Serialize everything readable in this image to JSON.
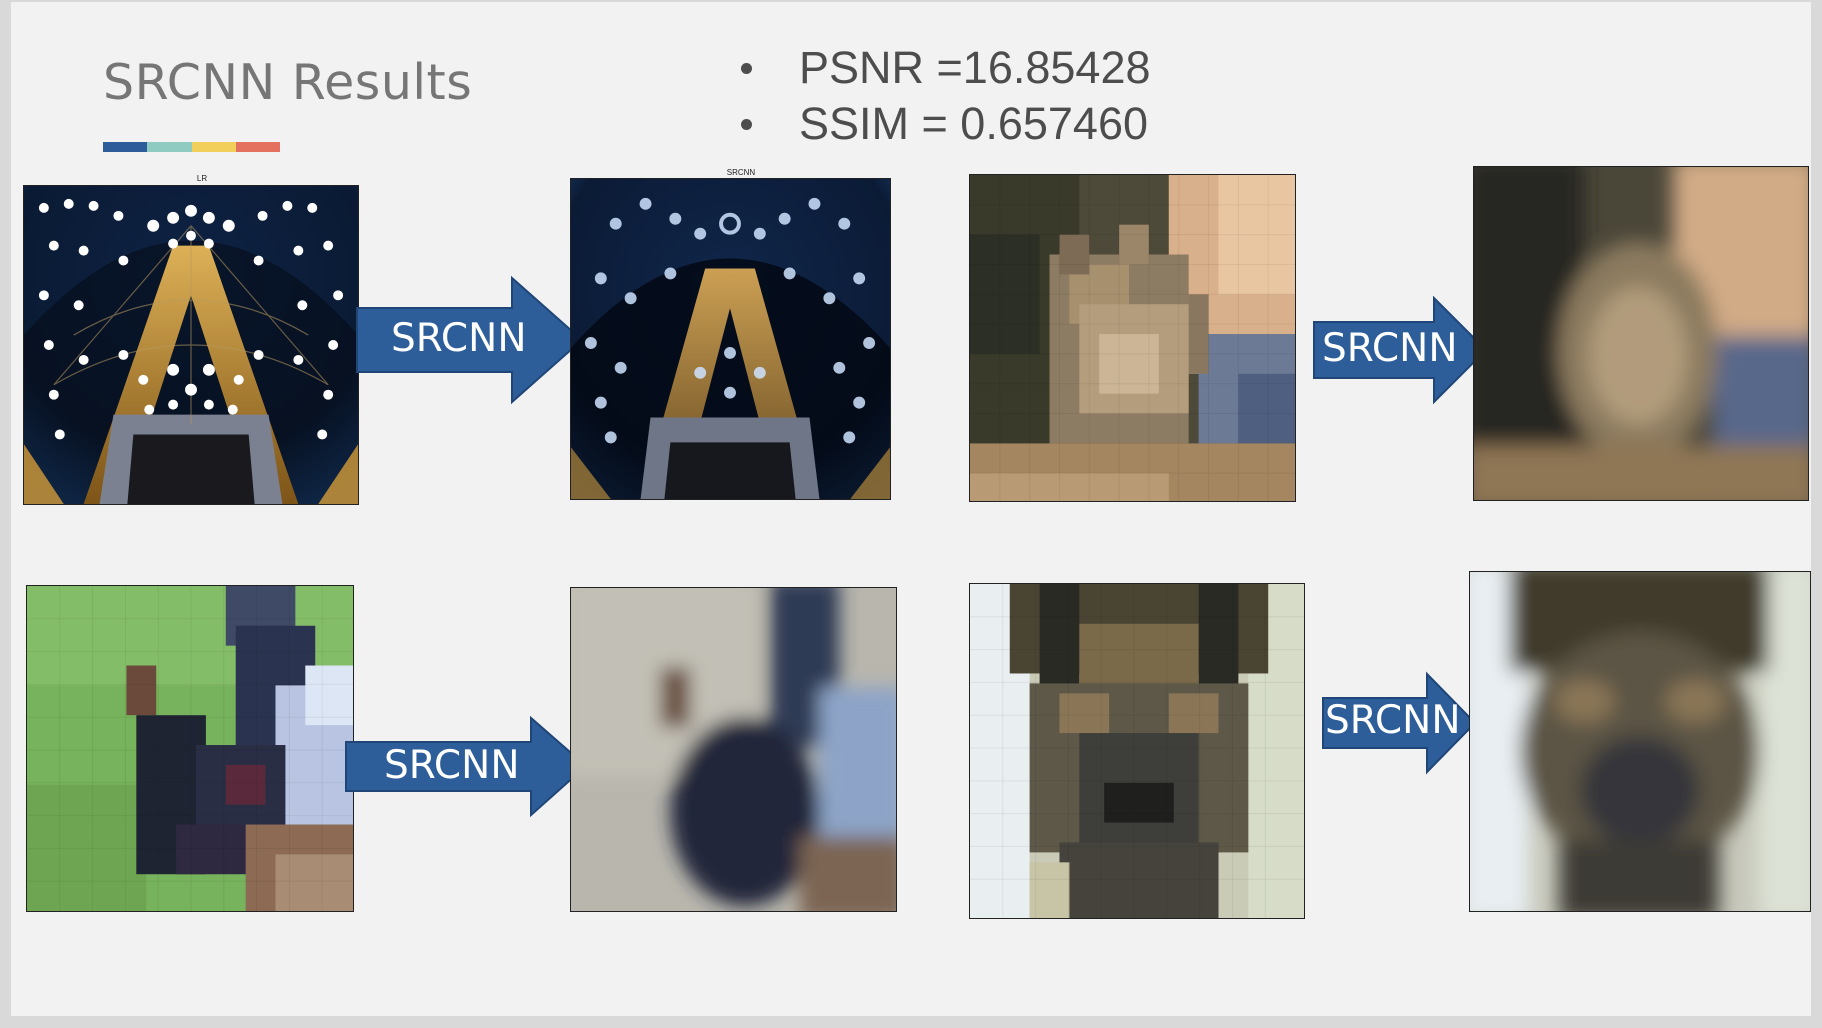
{
  "slide": {
    "title": "SRCNN Results",
    "title_bar_colors": [
      "#2e5b9a",
      "#8fcbc0",
      "#f2cf5b",
      "#e4705f"
    ],
    "metrics": [
      "PSNR =16.85428",
      "SSIM = 0.657460"
    ]
  },
  "panels": {
    "lr_caption": "LR",
    "srcnn_caption": "SRCNN"
  },
  "arrows": {
    "label": "SRCNN",
    "fill": "#2d5e9a",
    "stroke": "#1f4676"
  }
}
